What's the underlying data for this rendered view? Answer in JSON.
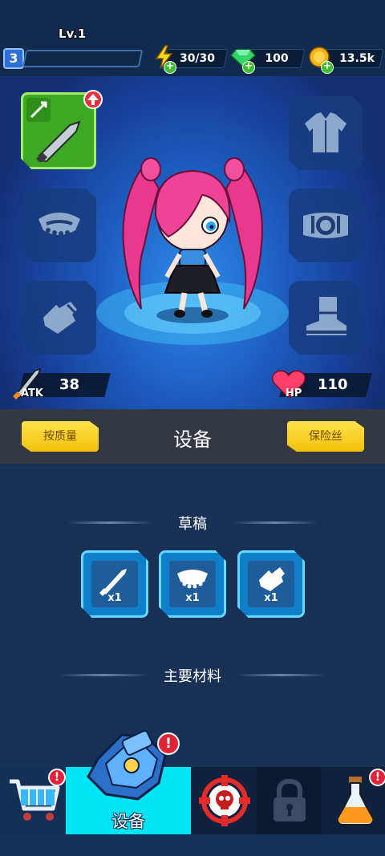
{
  "header": {
    "level": "3",
    "xp_fraction": 0.0,
    "energy": "30/30",
    "gems": "100",
    "coins": "13.5k"
  },
  "hero": {
    "weapon_level": "Lv.1",
    "atk_label": "ATK",
    "atk_value": "38",
    "hp_label": "HP",
    "hp_value": "110",
    "slots": [
      "weapon",
      "armor-shirt",
      "necklace",
      "belt",
      "gloves",
      "boots"
    ]
  },
  "titlebar": {
    "sort_button": "按质量",
    "title": "设备",
    "fuse_button": "保险丝"
  },
  "draft": {
    "heading": "草稿",
    "items": [
      {
        "icon": "sword-icon",
        "qty": "x1"
      },
      {
        "icon": "necklace-icon",
        "qty": "x1"
      },
      {
        "icon": "glove-icon",
        "qty": "x1"
      }
    ]
  },
  "materials": {
    "heading": "主要材料"
  },
  "nav": {
    "active_label": "设备",
    "tabs": [
      "shop",
      "equipment",
      "battle",
      "locked",
      "potion"
    ],
    "badge": "!"
  },
  "colors": {
    "accent_yellow": "#f2c20c",
    "active_tab": "#00e5f5",
    "badge_red": "#e2243b"
  }
}
